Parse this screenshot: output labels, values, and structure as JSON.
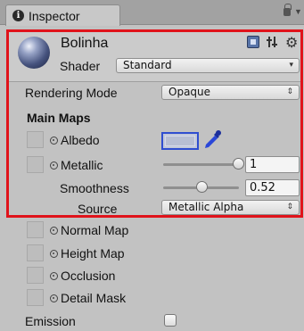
{
  "tab": {
    "title": "Inspector"
  },
  "material": {
    "name": "Bolinha",
    "shader_label": "Shader",
    "shader_value": "Standard"
  },
  "rendering_mode": {
    "label": "Rendering Mode",
    "value": "Opaque"
  },
  "main_maps": {
    "title": "Main Maps",
    "albedo_label": "Albedo",
    "albedo_color": "#b8bfd3",
    "metallic_label": "Metallic",
    "metallic_value": "1",
    "metallic_level": 1.0,
    "smoothness_label": "Smoothness",
    "smoothness_value": "0.52",
    "smoothness_level": 0.52,
    "source_label": "Source",
    "source_value": "Metallic Alpha"
  },
  "other_maps": [
    {
      "label": "Normal Map"
    },
    {
      "label": "Height Map"
    },
    {
      "label": "Occlusion"
    },
    {
      "label": "Detail Mask"
    }
  ],
  "emission": {
    "label": "Emission",
    "checked": false
  },
  "colors": {
    "highlight": "#e0131b",
    "swatch_border": "#2f4ed0",
    "eyedropper": "#2a47d8"
  },
  "icons": [
    "info-icon",
    "lock-icon",
    "menu-icon",
    "material-sphere-icon",
    "help-book-icon",
    "preset-icon",
    "gear-icon",
    "eyedropper-icon"
  ]
}
